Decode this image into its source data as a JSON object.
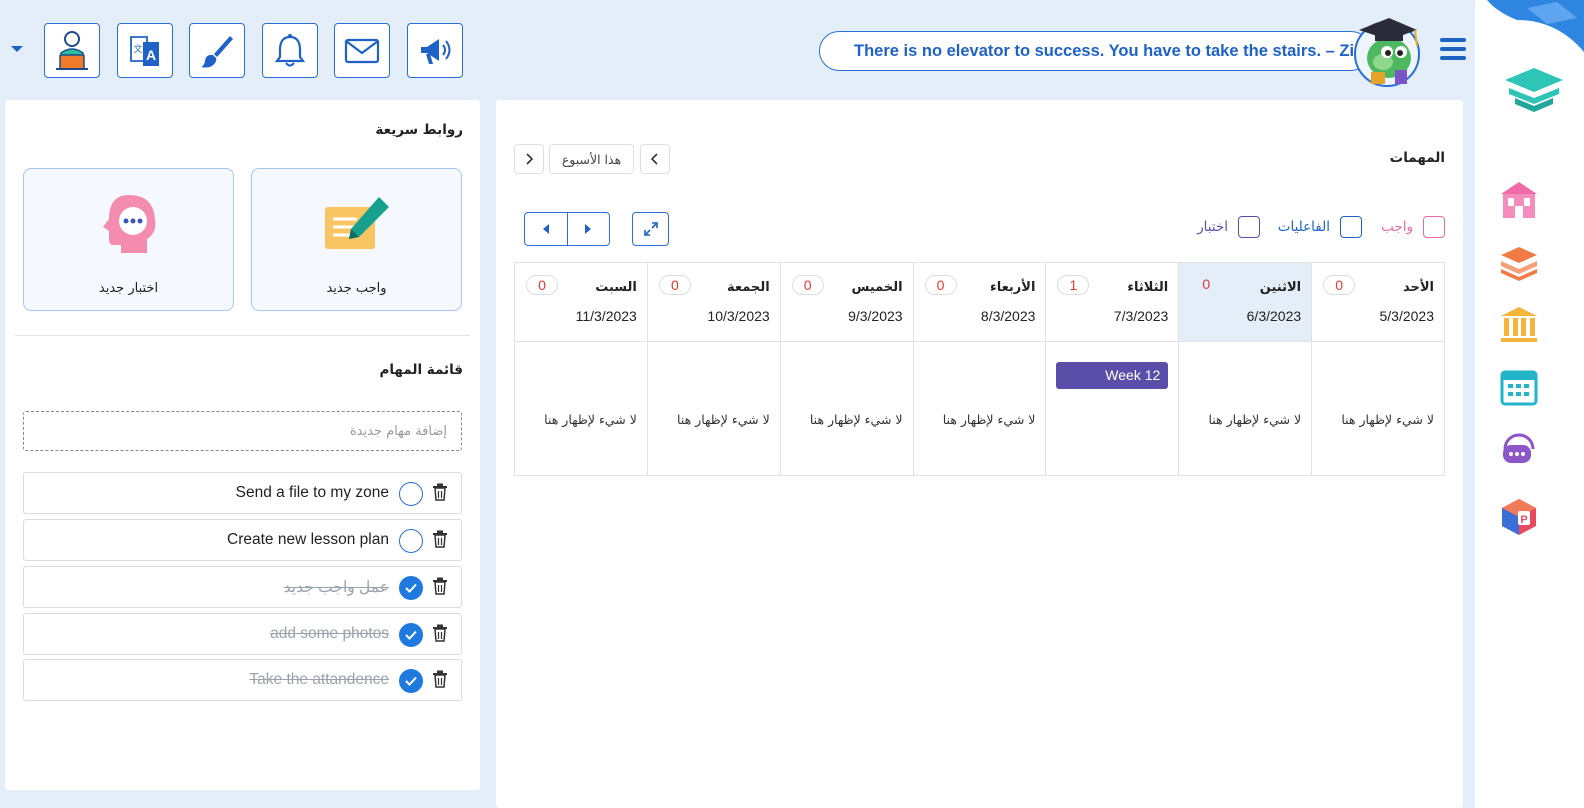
{
  "header": {
    "quote": "There is no elevator to success. You have to take the stairs. – Zig Ziglar",
    "tool_icons": [
      "profile-icon",
      "translate-icon",
      "paint-brush-icon",
      "bell-icon",
      "mail-icon",
      "megaphone-icon"
    ]
  },
  "quick_links": {
    "title": "روابط سريعة",
    "cards": [
      {
        "label": "واجب جديد",
        "icon": "homework-icon"
      },
      {
        "label": "اختبار جديد",
        "icon": "exam-icon"
      }
    ]
  },
  "tasks": {
    "title": "قائمة المهام",
    "input_placeholder": "إضافة مهام جديدة",
    "items": [
      {
        "text": "Send a file to my zone",
        "done": false
      },
      {
        "text": "Create new lesson plan",
        "done": false
      },
      {
        "text": "عمل واجب جديد",
        "done": true
      },
      {
        "text": "add some photos",
        "done": true
      },
      {
        "text": "Take the attandence",
        "done": true
      }
    ]
  },
  "main": {
    "title": "المهمات",
    "week_label": "هذا الأسبوع",
    "filters": [
      {
        "label": "واجب",
        "color": "#e86aa8"
      },
      {
        "label": "الفاعليات",
        "color": "#1f62c7"
      },
      {
        "label": "اختبار",
        "color": "#5a4fa8"
      }
    ],
    "days": [
      {
        "name": "الأحد",
        "date": "5/3/2023",
        "count": "0",
        "empty": "لا شيء لإظهار هنا"
      },
      {
        "name": "الاثنين",
        "date": "6/3/2023",
        "count": "0",
        "empty": "لا شيء لإظهار هنا"
      },
      {
        "name": "الثلاثاء",
        "date": "7/3/2023",
        "count": "1",
        "empty": "",
        "event": "Week 12"
      },
      {
        "name": "الأربعاء",
        "date": "8/3/2023",
        "count": "0",
        "empty": "لا شيء لإظهار هنا"
      },
      {
        "name": "الخميس",
        "date": "9/3/2023",
        "count": "0",
        "empty": "لا شيء لإظهار هنا"
      },
      {
        "name": "الجمعة",
        "date": "10/3/2023",
        "count": "0",
        "empty": "لا شيء لإظهار هنا"
      },
      {
        "name": "السبت",
        "date": "11/3/2023",
        "count": "0",
        "empty": "لا شيء لإظهار هنا"
      }
    ]
  },
  "sidebar": {
    "icons": [
      "school-icon",
      "books-icon",
      "institution-icon",
      "calendar-icon",
      "chat-icon",
      "app-cube-icon"
    ]
  }
}
